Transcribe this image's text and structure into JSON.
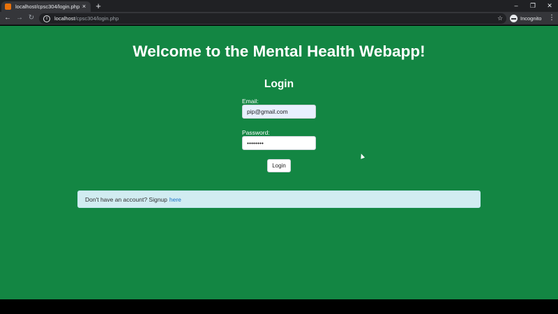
{
  "browser": {
    "tab_title": "localhost/cpsc304/login.php",
    "tab_close": "×",
    "new_tab": "+",
    "url_host": "localhost",
    "url_path": "/cpsc304/login.php",
    "incognito_label": "Incognito",
    "window_controls": {
      "minimize": "–",
      "maximize": "❐",
      "close": "✕"
    },
    "nav": {
      "back": "←",
      "forward": "→",
      "reload": "↻"
    },
    "star": "☆",
    "menu": "⋮",
    "lock_glyph": "i"
  },
  "page": {
    "heading": "Welcome to the Mental Health Webapp!",
    "login_heading": "Login",
    "email_label": "Email:",
    "email_value": "pip@gmail.com",
    "password_label": "Password:",
    "password_value": "••••••••",
    "login_button": "Login",
    "signup_prompt": "Don't have an account? Signup",
    "signup_link": "here"
  },
  "colors": {
    "page_background": "#138643",
    "alert_background": "#d1ecf1",
    "link": "#1a73c8"
  }
}
